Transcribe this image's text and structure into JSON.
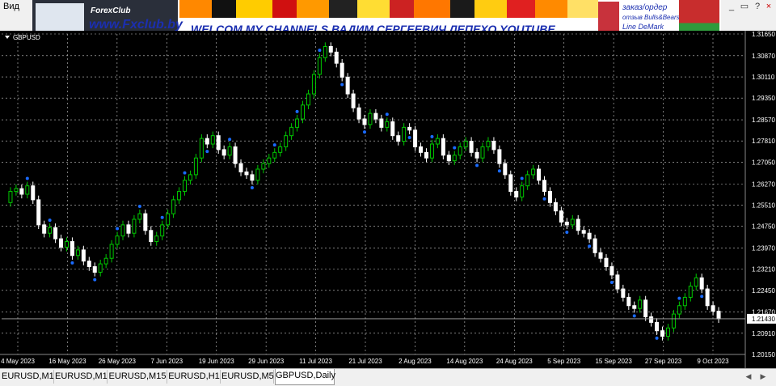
{
  "menu": {
    "view_label": "Вид"
  },
  "window_controls": {
    "minimize": "_",
    "close": "×"
  },
  "banner": {
    "logo_text": "ForexClub",
    "site": "www.Fxclub.by",
    "welcome": "WELCOM MY CHANNELS ВАДИМ СЕРГЕЕВИЧ ЛЕПЕХО YOUTUBE",
    "ad_line1": "заказ/ордер",
    "ad_line2": "отзыв Bulls&Bears",
    "ad_line3": "Line DeMark"
  },
  "chart": {
    "symbol_label": "GBPUSD",
    "current_price": "1.21430",
    "colors": {
      "background": "#000000",
      "grid": "#c8c8c8",
      "bull_candle": "#00c800",
      "bear_candle": "#ffffff",
      "arrow": "#1a6bff",
      "axis_text": "#ffffff"
    }
  },
  "chart_data": {
    "type": "candlestick",
    "y_ticks": [
      "1.31650",
      "1.30870",
      "1.30110",
      "1.29350",
      "1.28570",
      "1.27810",
      "1.27050",
      "1.26270",
      "1.25510",
      "1.24750",
      "1.23970",
      "1.23210",
      "1.22450",
      "1.21670",
      "1.20910",
      "1.20150"
    ],
    "x_ticks": [
      "4 May 2023",
      "16 May 2023",
      "26 May 2023",
      "7 Jun 2023",
      "19 Jun 2023",
      "29 Jun 2023",
      "11 Jul 2023",
      "21 Jul 2023",
      "2 Aug 2023",
      "14 Aug 2023",
      "24 Aug 2023",
      "5 Sep 2023",
      "15 Sep 2023",
      "27 Sep 2023",
      "9 Oct 2023"
    ],
    "ylim": [
      1.2015,
      1.3165
    ],
    "close_series": [
      1.256,
      1.26,
      1.261,
      1.259,
      1.262,
      1.257,
      1.248,
      1.245,
      1.247,
      1.243,
      1.24,
      1.242,
      1.237,
      1.239,
      1.235,
      1.233,
      1.231,
      1.234,
      1.236,
      1.241,
      1.244,
      1.248,
      1.245,
      1.25,
      1.252,
      1.246,
      1.242,
      1.244,
      1.248,
      1.252,
      1.257,
      1.26,
      1.264,
      1.266,
      1.272,
      1.279,
      1.277,
      1.28,
      1.275,
      1.273,
      1.276,
      1.27,
      1.267,
      1.266,
      1.264,
      1.268,
      1.27,
      1.272,
      1.274,
      1.276,
      1.28,
      1.283,
      1.286,
      1.291,
      1.295,
      1.302,
      1.308,
      1.312,
      1.31,
      1.306,
      1.301,
      1.295,
      1.29,
      1.286,
      1.284,
      1.288,
      1.286,
      1.283,
      1.285,
      1.28,
      1.278,
      1.283,
      1.282,
      1.276,
      1.274,
      1.272,
      1.277,
      1.279,
      1.273,
      1.271,
      1.273,
      1.276,
      1.278,
      1.274,
      1.272,
      1.276,
      1.278,
      1.275,
      1.27,
      1.266,
      1.26,
      1.258,
      1.262,
      1.266,
      1.268,
      1.264,
      1.26,
      1.256,
      1.253,
      1.249,
      1.248,
      1.25,
      1.246,
      1.245,
      1.243,
      1.238,
      1.236,
      1.233,
      1.23,
      1.225,
      1.222,
      1.219,
      1.218,
      1.221,
      1.215,
      1.213,
      1.21,
      1.208,
      1.211,
      1.216,
      1.219,
      1.222,
      1.226,
      1.229,
      1.225,
      1.219,
      1.217,
      1.2143
    ]
  },
  "tabs": [
    {
      "label": "EURUSD,M1"
    },
    {
      "label": "EURUSD,M1"
    },
    {
      "label": "EURUSD,M15"
    },
    {
      "label": "EURUSD,H1"
    },
    {
      "label": "EURUSD,M5"
    },
    {
      "label": "GBPUSD,Daily"
    }
  ]
}
